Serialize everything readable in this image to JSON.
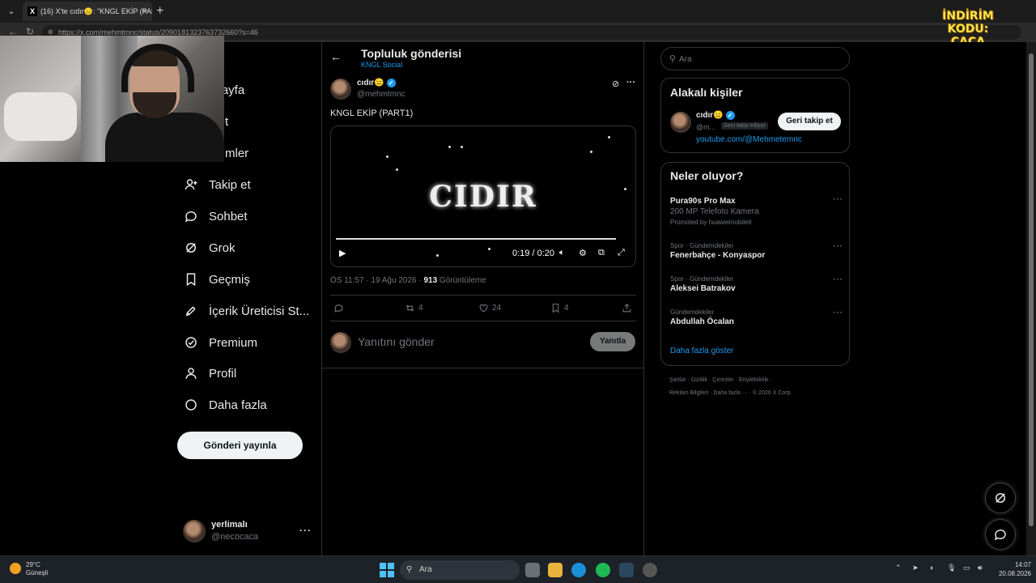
{
  "browser": {
    "tab_title": "(16) X'te cıdır😑: \"KNGL EKİP (PAR",
    "tab_close": "✕",
    "new_tab": "+",
    "url": "https://x.com/mehmtmnc/status/2090181323763732660?s=46",
    "promo_line1": "İNDİRİM KODU:",
    "promo_line2": "ÇAÇA"
  },
  "nav": {
    "items": [
      {
        "label": "asayfa",
        "icon": "home-icon"
      },
      {
        "label": "şfet",
        "icon": "search-icon"
      },
      {
        "label": "dirimler",
        "icon": "bell-icon"
      },
      {
        "label": "Takip et",
        "icon": "add-person-icon"
      },
      {
        "label": "Sohbet",
        "icon": "chat-icon"
      },
      {
        "label": "Grok",
        "icon": "grok-icon"
      },
      {
        "label": "Geçmiş",
        "icon": "bookmark-icon"
      },
      {
        "label": "İçerik Üreticisi St...",
        "icon": "rocket-icon"
      },
      {
        "label": "Premium",
        "icon": "verified-icon"
      },
      {
        "label": "Profil",
        "icon": "person-icon"
      },
      {
        "label": "Daha fazla",
        "icon": "more-circle-icon"
      }
    ],
    "post_button": "Gönderi yayınla",
    "me": {
      "name": "yerlimalı",
      "handle": "@necocaca",
      "more": "···"
    }
  },
  "main": {
    "title": "Topluluk gönderisi",
    "subtitle": "KNGL Social",
    "post": {
      "author": "cıdır😑",
      "handle": "@mehmtmnc",
      "text": "KNGL EKİP (PART1)",
      "video_title": "CIDIR",
      "video_time": "0:19 / 0:20",
      "video_progress": 0.95,
      "timestamp": "ÖS 11:57 · 19 Ağu 2026 · ",
      "views": "913",
      "views_label": " Görüntüleme",
      "retweets": "4",
      "likes": "24",
      "bookmarks": "4"
    },
    "reply_placeholder": "Yanıtını gönder",
    "reply_button": "Yanıtla"
  },
  "right": {
    "search_placeholder": "Ara",
    "related_title": "Alakalı kişiler",
    "related": {
      "name": "cıdır😑",
      "handle": "@m...",
      "badge": "Seni takip ediyor",
      "follow": "Geri takip et",
      "link": "youtube.com/@Mehmetemnc"
    },
    "trends_title": "Neler oluyor?",
    "trends": [
      {
        "category": "",
        "title": "Pura90s Pro Max",
        "subtitle": "200 MP Telefoto Kamera",
        "promoted": "Promoted by huaweimobiletr"
      },
      {
        "category": "Spor · Gündemdekiler",
        "title": "Fenerbahçe - Konyaspor",
        "subtitle": "",
        "promoted": ""
      },
      {
        "category": "Spor · Gündemdekiler",
        "title": "Aleksei Batrakov",
        "subtitle": "",
        "promoted": ""
      },
      {
        "category": "Gündemdekiler",
        "title": "Abdullah Öcalan",
        "subtitle": "",
        "promoted": ""
      }
    ],
    "trend_more": "···",
    "show_more": "Daha fazla göster",
    "footer_line1": "Şartlar  ·  Gizlilik  ·  Çerezler  ·  Erişilebilirlik  ·",
    "footer_line2": "Reklam Bilgileri  ·  Daha fazla ···  ·  © 2026 X Corp."
  },
  "taskbar": {
    "temp": "29°C",
    "weather": "Güneşli",
    "search": "Ara",
    "time": "14:07",
    "date": "20.08.2026"
  }
}
